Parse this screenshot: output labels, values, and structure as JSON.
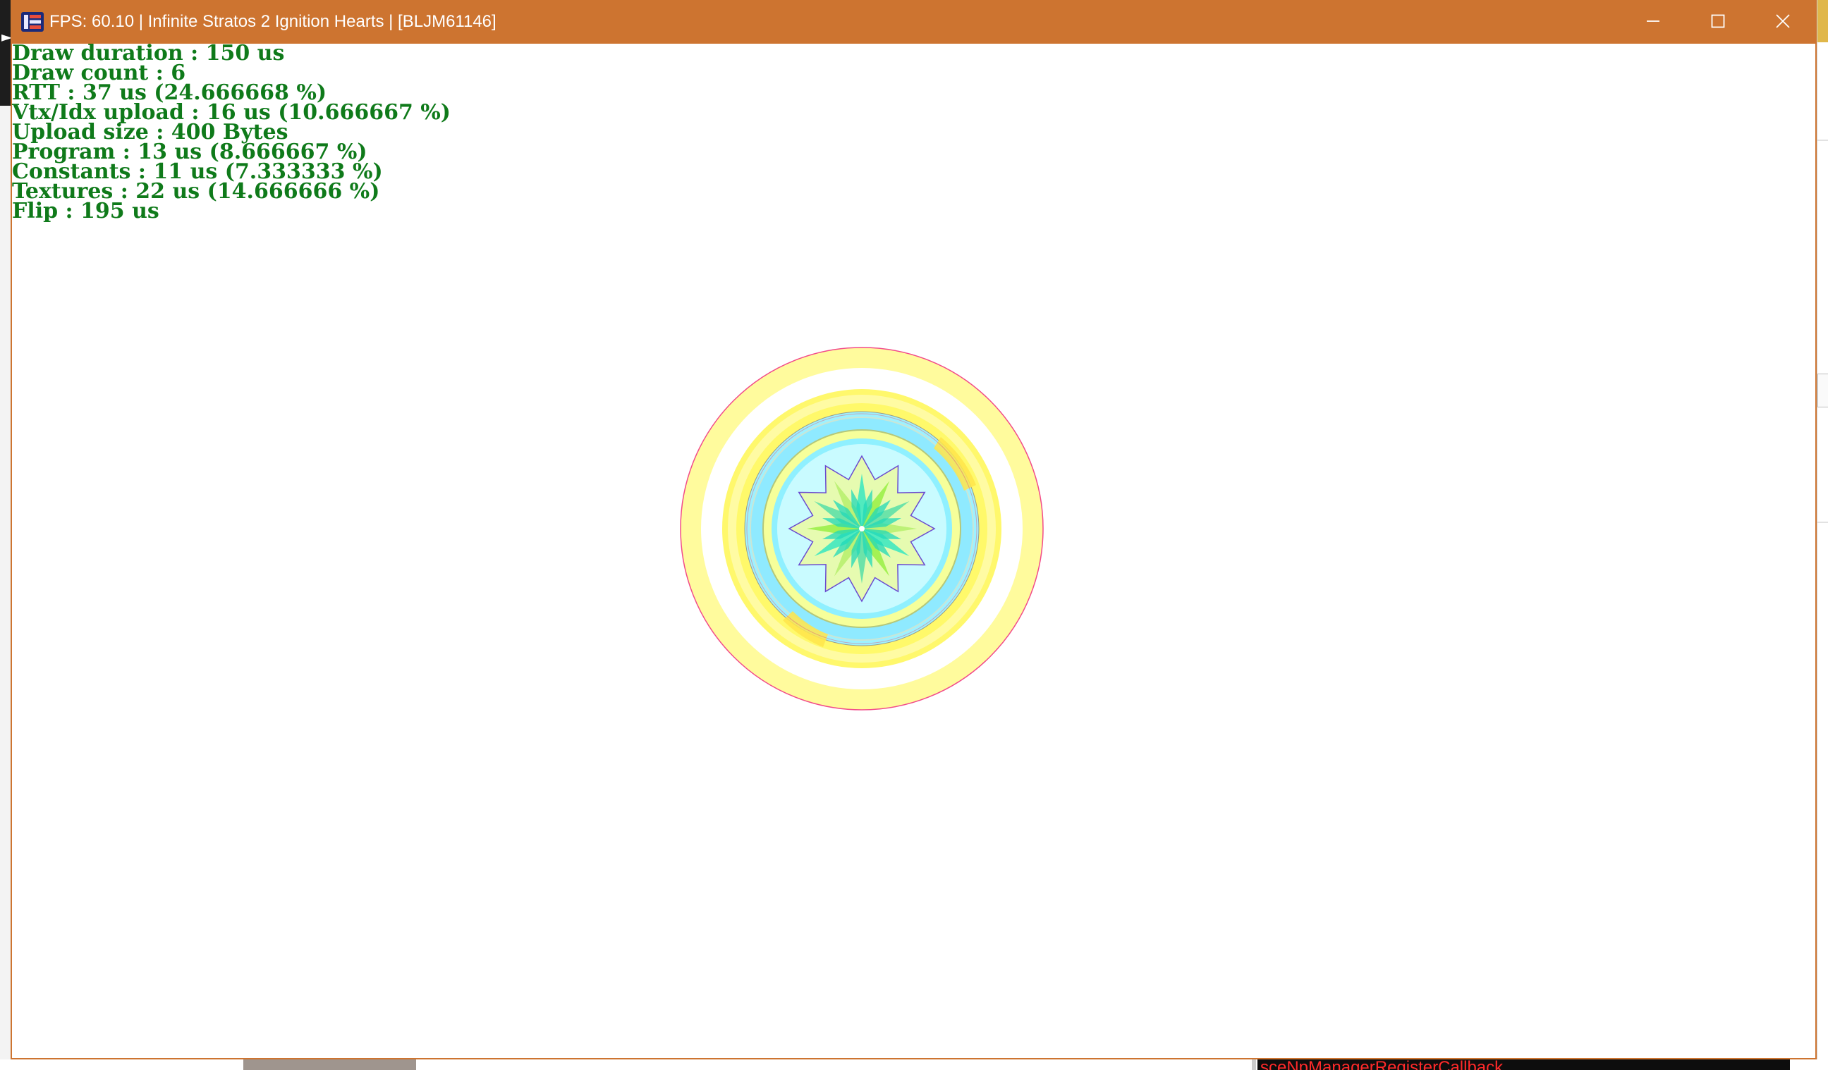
{
  "window": {
    "title": "FPS: 60.10 | Infinite Stratos 2 Ignition Hearts | [BLJM61146]",
    "accent_color": "#cd7430",
    "icons": {
      "app": "rpcs3-app-icon",
      "minimize": "minimize-icon",
      "maximize": "maximize-icon",
      "close": "close-icon"
    }
  },
  "overlay": {
    "text_color": "#0f7a1a",
    "lines": [
      "Draw duration : 150 us",
      "Draw count : 6",
      "RTT : 37 us (24.666668 %)",
      "Vtx/Idx upload : 16 us (10.666667 %)",
      "Upload size : 400 Bytes",
      "Program : 13 us (8.666667 %)",
      "Constants : 11 us (7.333333 %)",
      "Textures : 22 us (14.666666 %)",
      "Flip : 195 us"
    ]
  },
  "background": {
    "console_text": "sceNpManagerRegisterCallback",
    "console_color": "#ff2a2a"
  }
}
